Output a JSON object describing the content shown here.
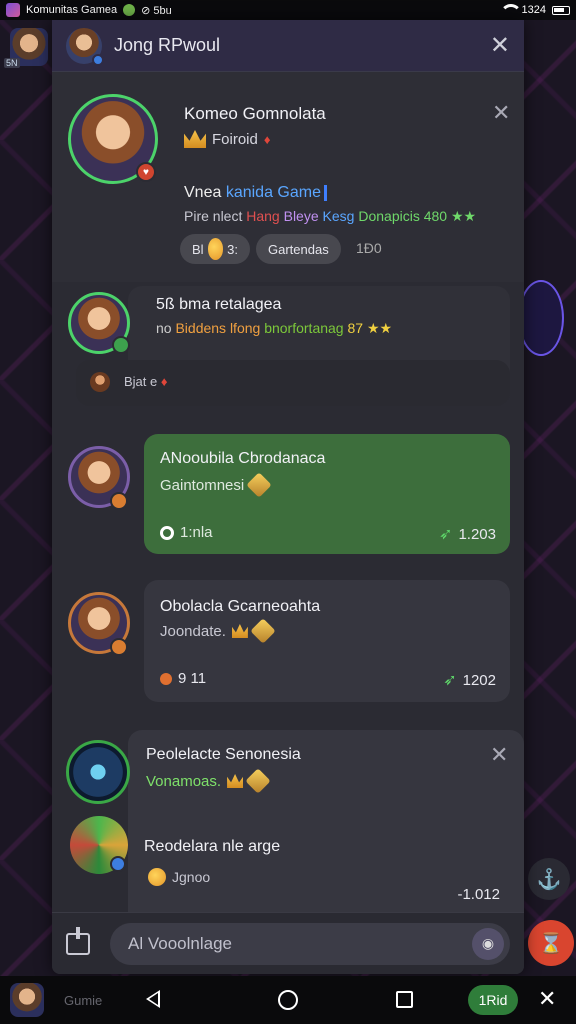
{
  "status_bar": {
    "app_name": "Komunitas Gamea",
    "extra": "⊘ 5bu",
    "time": "1324"
  },
  "background": {
    "badge": "5N"
  },
  "panel": {
    "title": "Jong RPwoul",
    "cards": [
      {
        "name": "Komeo Gomnolata",
        "sub": "Foiroid",
        "line1_a": "Vnea ",
        "line1_b": "kanida Game",
        "line2_a": "Pire nlect ",
        "line2_b": "Hang ",
        "line2_c": "Bleye ",
        "line2_d": "Kesg ",
        "line2_e": "Donapicis 480 ★★",
        "chip1": "3:",
        "chip1_prefix": "Bl",
        "chip2": "Gartendas",
        "count": "1Đ0"
      },
      {
        "name": "5ß bma retalagea",
        "line_a": "no ",
        "line_b": "Biddens lfong ",
        "line_c": "bnorfortanag ",
        "line_d": "87 ★★",
        "reply": "Bjat e"
      },
      {
        "name": "ANooubila Cbrodanaca",
        "sub": "Gaintomnesi",
        "left_stat": "1:nla",
        "right_stat": "1.203"
      },
      {
        "name": "Obolacla Gcarneoahta",
        "sub": "Joondate.",
        "left_stat": "9 11",
        "right_stat": "1202"
      },
      {
        "name": "Peolelacte Senonesia",
        "sub": "Vonamoas.",
        "name2": "Reodelara nle arge",
        "sub2": "Jgnoo",
        "right_stat": "-1.012"
      }
    ],
    "input_placeholder": "Al Vooolnlage"
  },
  "nav": {
    "label": "Gumie",
    "pill": "1Rid"
  }
}
